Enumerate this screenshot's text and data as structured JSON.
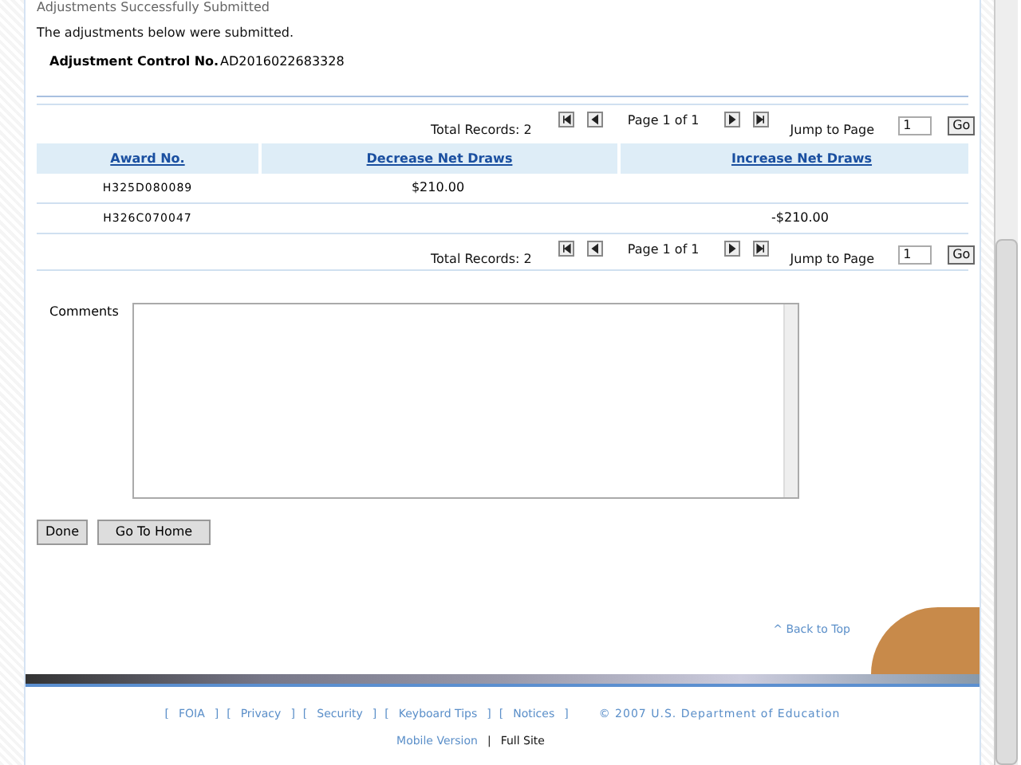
{
  "heading": "Adjustments Successfully Submitted",
  "message": "The adjustments below were submitted.",
  "control": {
    "label": "Adjustment Control No.",
    "value": "AD2016022683328"
  },
  "pagers": [
    {
      "total": "Total Records: 2",
      "page": "Page 1 of 1",
      "jump_label": "Jump to Page",
      "jump_value": "1",
      "go": "Go"
    },
    {
      "total": "Total Records: 2",
      "page": "Page 1 of 1",
      "jump_label": "Jump to Page",
      "jump_value": "1",
      "go": "Go"
    }
  ],
  "table": {
    "columns": [
      "Award No.",
      "Decrease Net Draws",
      "Increase Net Draws"
    ],
    "rows": [
      [
        "H325D080089",
        "$210.00",
        ""
      ],
      [
        "H326C070047",
        "",
        "-$210.00"
      ]
    ]
  },
  "comments": {
    "label": "Comments"
  },
  "buttons": [
    "Done",
    "Go To Home"
  ],
  "back_to_top": "^ Back to Top",
  "footer": {
    "links": [
      {
        "open": "[",
        "label": "FOIA",
        "close": "]"
      },
      {
        "open": "[",
        "label": "Privacy",
        "close": "]"
      },
      {
        "open": "[",
        "label": "Security",
        "close": "]"
      },
      {
        "open": "[",
        "label": "Keyboard Tips",
        "close": "]"
      },
      {
        "open": "[",
        "label": "Notices",
        "close": "]"
      }
    ],
    "copyright": "© 2007 U.S. Department of Education",
    "mobile": "Mobile Version",
    "separator": "|",
    "full": "Full Site"
  }
}
